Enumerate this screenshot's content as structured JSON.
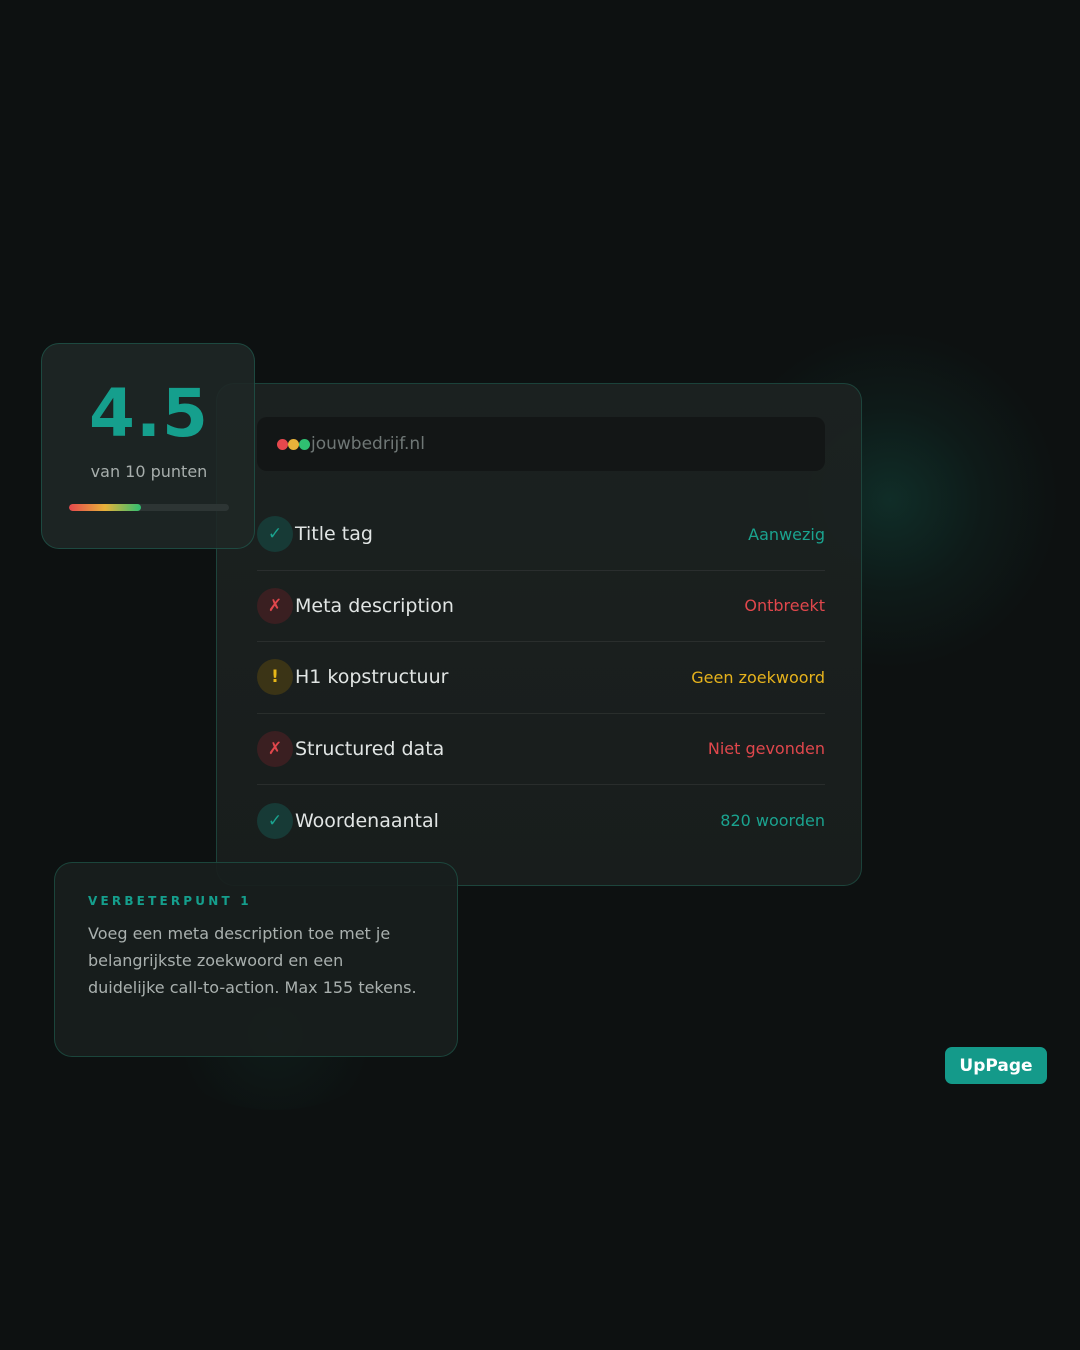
{
  "score": {
    "value": "4.5",
    "caption": "van 10 punten",
    "fraction": 0.45
  },
  "browser": {
    "url": "jouwbedrijf.nl"
  },
  "checks": [
    {
      "label": "Title tag",
      "value": "Aanwezig",
      "status": "ok",
      "icon": "✓"
    },
    {
      "label": "Meta description",
      "value": "Ontbreekt",
      "status": "bad",
      "icon": "✗"
    },
    {
      "label": "H1 kopstructuur",
      "value": "Geen zoekwoord",
      "status": "warn",
      "icon": "!"
    },
    {
      "label": "Structured data",
      "value": "Niet gevonden",
      "status": "bad",
      "icon": "✗"
    },
    {
      "label": "Woordenaantal",
      "value": "820 woorden",
      "status": "ok",
      "icon": "✓"
    }
  ],
  "tip": {
    "title": "VERBETERPUNT 1",
    "body": "Voeg een meta description toe met je belangrijkste zoekwoord en een duidelijke call-to-action. Max 155 tekens."
  },
  "brand": {
    "label": "UpPage"
  },
  "colors": {
    "accent": "#149a8a",
    "ok": "#1aa38f",
    "bad": "#e0474c",
    "warn": "#e6b21c"
  }
}
